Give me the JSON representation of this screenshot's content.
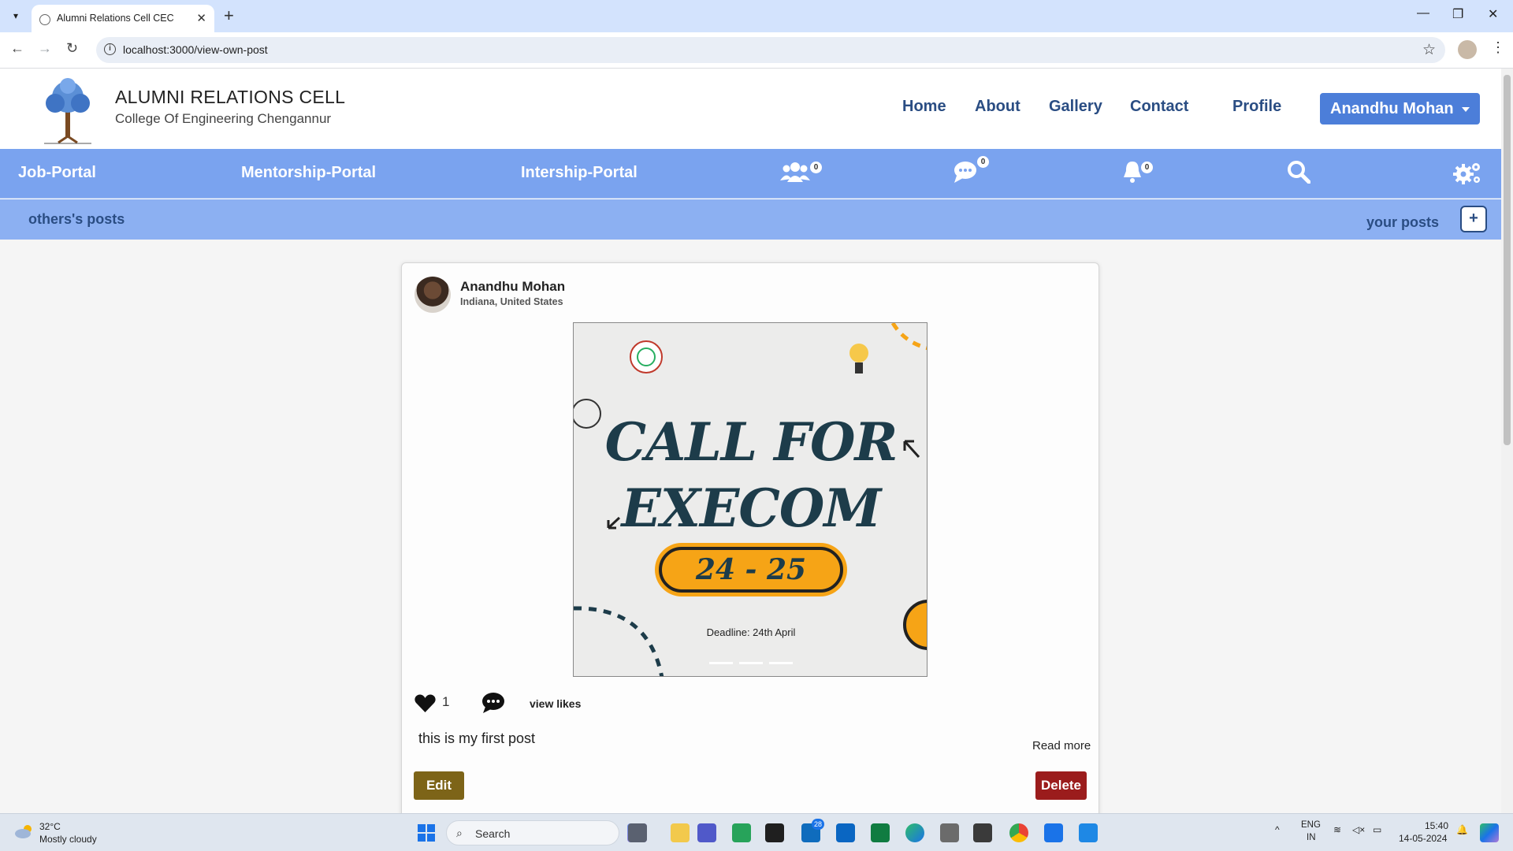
{
  "browser": {
    "tab_title": "Alumni Relations Cell CEC",
    "url": "localhost:3000/view-own-post"
  },
  "site": {
    "title": "ALUMNI RELATIONS CELL",
    "subtitle": "College Of Engineering Chengannur",
    "nav": [
      "Home",
      "About",
      "Gallery",
      "Contact",
      "Profile"
    ],
    "user_button": "Anandhu Mohan"
  },
  "portal_bar": {
    "links": [
      "Job-Portal",
      "Mentorship-Portal",
      "Intership-Portal"
    ],
    "icons": [
      {
        "name": "users-icon",
        "badge": "0"
      },
      {
        "name": "chat-icon",
        "badge": "0"
      },
      {
        "name": "bell-icon",
        "badge": "0"
      },
      {
        "name": "search-icon"
      },
      {
        "name": "settings-icon"
      }
    ]
  },
  "posts_bar": {
    "others": "others's posts",
    "yours": "your posts",
    "add": "+"
  },
  "post": {
    "author": "Anandhu Mohan",
    "location": "Indiana, United States",
    "image": {
      "line1": "CALL FOR",
      "line2": "EXECOM",
      "years": "24 - 25",
      "deadline": "Deadline: 24th April"
    },
    "likes": "1",
    "view_likes": "view likes",
    "text": "this is my first post",
    "read_more": "Read more",
    "edit": "Edit",
    "delete": "Delete"
  },
  "taskbar": {
    "temperature": "32°C",
    "condition": "Mostly cloudy",
    "search": "Search",
    "mail_badge": "28",
    "lang1": "ENG",
    "lang2": "IN",
    "time": "15:40",
    "date": "14-05-2024"
  },
  "colors": {
    "nav_text": "#2a4d83",
    "portal_bar": "#7aa3ef",
    "sub_bar": "#8cb0f2",
    "user_button": "#4c7ed9",
    "edit_button": "#7d6418",
    "delete_button": "#9b1c1c",
    "poster_accent": "#f6a416"
  }
}
